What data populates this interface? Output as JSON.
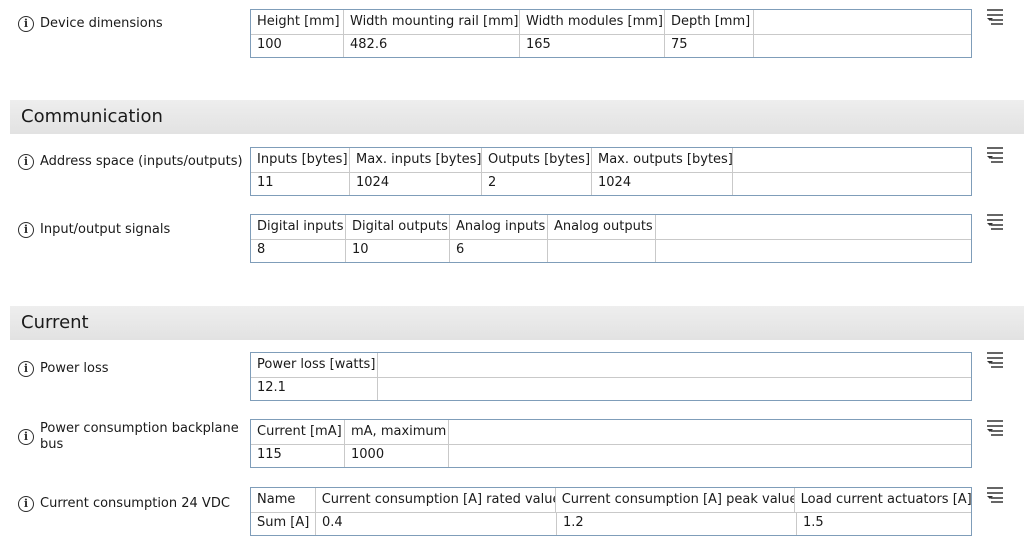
{
  "device_dimensions": {
    "label": "Device dimensions",
    "headers": [
      "Height [mm]",
      "Width mounting rail [mm]",
      "Width modules [mm]",
      "Depth [mm]"
    ],
    "values": [
      "100",
      "482.6",
      "165",
      "75"
    ]
  },
  "communication": {
    "title": "Communication",
    "address_space": {
      "label": "Address space (inputs/outputs)",
      "headers": [
        "Inputs [bytes]",
        "Max. inputs [bytes]",
        "Outputs [bytes]",
        "Max. outputs [bytes]"
      ],
      "values": [
        "11",
        "1024",
        "2",
        "1024"
      ]
    },
    "io_signals": {
      "label": "Input/output signals",
      "headers": [
        "Digital inputs",
        "Digital outputs",
        "Analog inputs",
        "Analog outputs"
      ],
      "values": [
        "8",
        "10",
        "6",
        ""
      ]
    }
  },
  "current": {
    "title": "Current",
    "power_loss": {
      "label": "Power loss",
      "headers": [
        "Power loss [watts]"
      ],
      "values": [
        "12.1"
      ]
    },
    "backplane": {
      "label": "Power consumption backplane bus",
      "headers": [
        "Current [mA]",
        "mA, maximum"
      ],
      "values": [
        "115",
        "1000"
      ]
    },
    "consumption_24v": {
      "label": "Current consumption 24 VDC",
      "headers": [
        "Name",
        "Current consumption [A] rated value",
        "Current consumption [A] peak value",
        "Load current actuators [A]"
      ],
      "values": [
        "Sum [A]",
        "0.4",
        "1.2",
        "1.5"
      ]
    }
  },
  "icons": {
    "info": "info-icon",
    "filter": "filter-list-icon"
  },
  "colors": {
    "table_border": "#7f9db9",
    "section_bg": "#e8e8e8"
  }
}
